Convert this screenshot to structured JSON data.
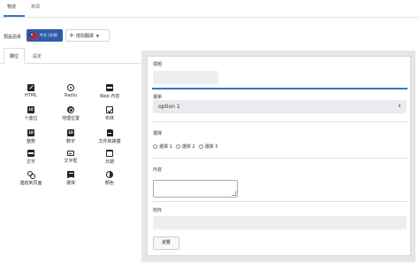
{
  "top_tabs": [
    {
      "label": "物流"
    },
    {
      "label": "來源"
    }
  ],
  "language": {
    "label": "預設語系",
    "selected": "中文 (台灣)",
    "add_translation": "增加翻譯"
  },
  "inner_tabs": [
    {
      "label": "欄位"
    },
    {
      "label": "設定"
    }
  ],
  "palette": [
    {
      "icon": "pencil-icon",
      "label": "HTML"
    },
    {
      "icon": "radio-icon",
      "label": "Radio"
    },
    {
      "icon": "web-content-icon",
      "label": "Web 內容"
    },
    {
      "icon": "number-icon",
      "label": "十進位"
    },
    {
      "icon": "globe-icon",
      "label": "地理位置"
    },
    {
      "icon": "checkbox-icon",
      "label": "布林"
    },
    {
      "icon": "number-icon",
      "label": "整數"
    },
    {
      "icon": "number-icon",
      "label": "數字"
    },
    {
      "icon": "file-icon",
      "label": "文件和媒體"
    },
    {
      "icon": "text-icon",
      "label": "文字"
    },
    {
      "icon": "text-box-icon",
      "label": "文字框"
    },
    {
      "icon": "calendar-icon",
      "label": "日期"
    },
    {
      "icon": "link-icon",
      "label": "連結到頁面"
    },
    {
      "icon": "menu-icon",
      "label": "選擇"
    },
    {
      "icon": "color-icon",
      "label": "顏色"
    }
  ],
  "preview": {
    "title_label": "標題",
    "select_label": "選單",
    "select_value": "option 1",
    "radio_label": "選擇",
    "radio_options": [
      "選擇 1",
      "選擇 2",
      "選擇 3"
    ],
    "content_label": "內容",
    "attachment_label": "附件",
    "browse_button": "瀏覽"
  }
}
